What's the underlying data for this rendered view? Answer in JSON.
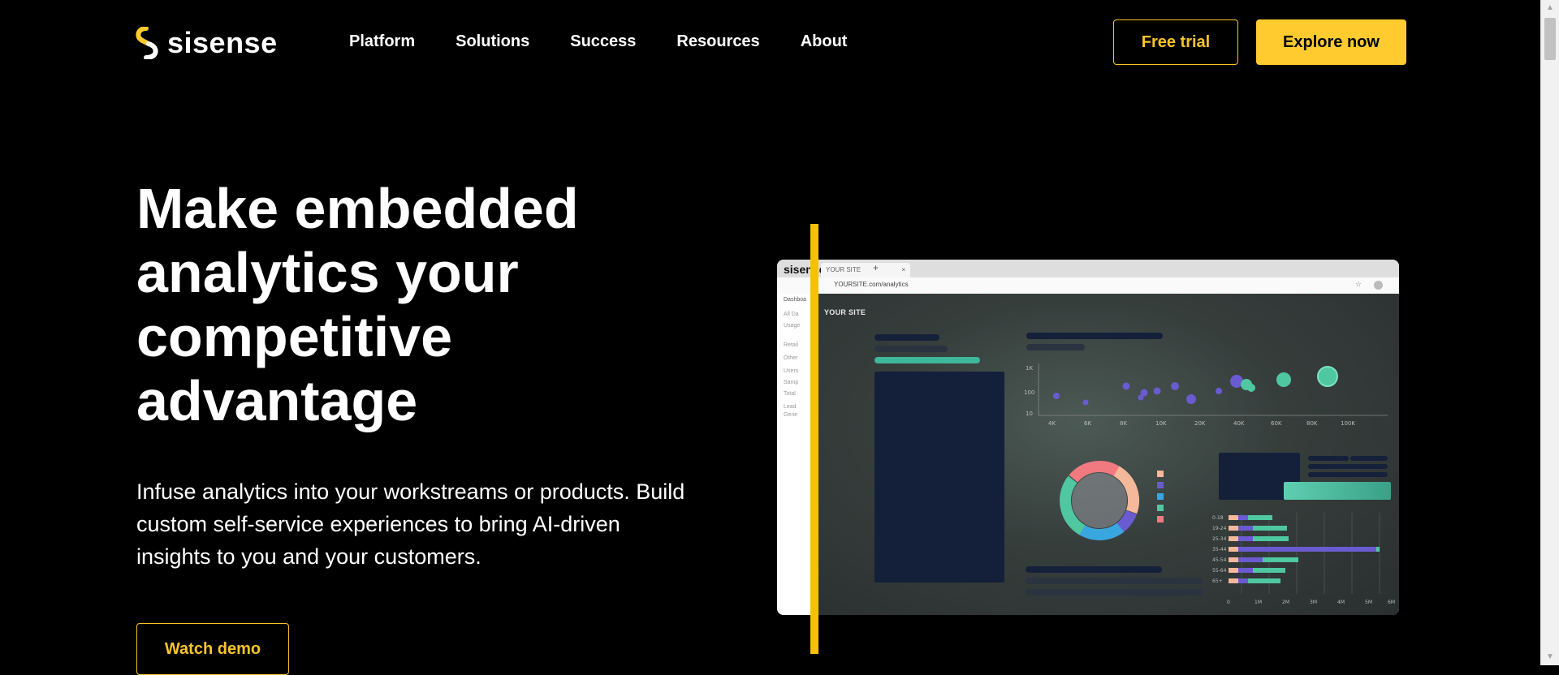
{
  "header": {
    "logo_text": "sisense",
    "nav": [
      "Platform",
      "Solutions",
      "Success",
      "Resources",
      "About"
    ],
    "free_trial_label": "Free trial",
    "explore_label": "Explore now"
  },
  "hero": {
    "title": "Make embedded analytics your competitive advantage",
    "subtitle": "Infuse analytics into your workstreams or products. Build custom self-service experiences to bring AI-driven insights to you and your customers.",
    "watch_demo_label": "Watch demo"
  },
  "mock": {
    "tab_label": "YOUR SITE",
    "tab_close": "×",
    "new_tab": "+",
    "url": "YOURSITE.com/analytics",
    "dashboard_label": "Dashboa",
    "dashboard_title": "YOUR SITE",
    "sidebar_items": [
      "All Da",
      "Usage",
      "Retail",
      "Other",
      "Users",
      "Samp",
      "Total",
      "Lead",
      "Gene"
    ],
    "scatter": {
      "y_ticks": [
        "1K",
        "100",
        "10"
      ],
      "x_ticks": [
        "4K",
        "6K",
        "8K",
        "10K",
        "20K",
        "40K",
        "60K",
        "80K",
        "100K"
      ]
    },
    "bar_chart": {
      "categories": [
        "0-18",
        "19-24",
        "25-34",
        "35-44",
        "45-54",
        "55-64",
        "65+"
      ],
      "x_ticks": [
        "0",
        "1M",
        "2M",
        "3M",
        "4M",
        "5M",
        "6M"
      ]
    }
  },
  "colors": {
    "accent": "#ffcb2f",
    "background": "#000000",
    "line": "#f6c200"
  }
}
